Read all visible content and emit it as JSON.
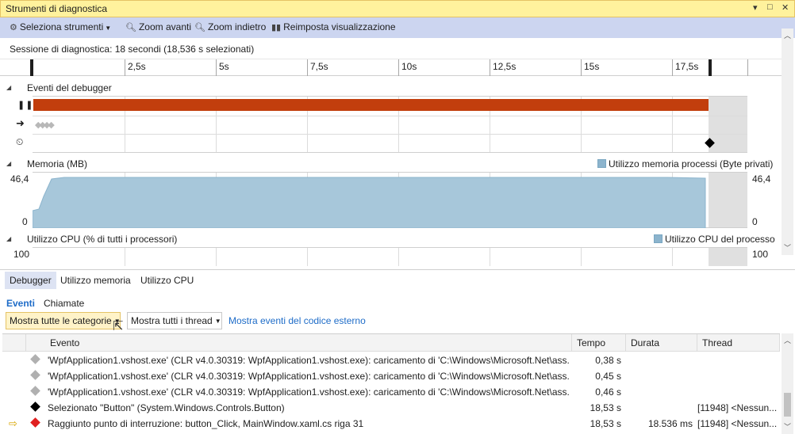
{
  "window": {
    "title": "Strumenti di diagnostica",
    "pin_glyph": "▾",
    "dock_glyph": "□",
    "close_glyph": "✕"
  },
  "toolbar": {
    "select_tools": "Seleziona strumenti",
    "zoom_in": "Zoom avanti",
    "zoom_out": "Zoom indietro",
    "reset_view": "Reimposta visualizzazione"
  },
  "session": {
    "label": "Sessione di diagnostica: 18 secondi (18,536 s selezionati)"
  },
  "ruler": {
    "ticks": [
      "2,5s",
      "5s",
      "7,5s",
      "10s",
      "12,5s",
      "15s",
      "17,5s"
    ]
  },
  "debugger_events": {
    "header": "Eventi del debugger",
    "break_color": "#c23e0d",
    "event_marker_color": "#000000"
  },
  "memory": {
    "header": "Memoria (MB)",
    "legend": "Utilizzo memoria processi (Byte privati)",
    "max_label": "46,4",
    "min_label": "0",
    "fill_color": "#a7c7da"
  },
  "cpu": {
    "header": "Utilizzo CPU (% di tutti i processori)",
    "legend": "Utilizzo CPU del processo",
    "max_label": "100"
  },
  "tabs": [
    "Debugger",
    "Utilizzo memoria",
    "Utilizzo CPU"
  ],
  "subtabs": [
    "Eventi",
    "Chiamate"
  ],
  "filters": {
    "categories": "Mostra tutte le categorie",
    "threads": "Mostra tutti i thread",
    "external_link": "Mostra eventi del codice esterno"
  },
  "table": {
    "columns": [
      "Evento",
      "Tempo",
      "Durata",
      "Thread"
    ],
    "rows": [
      {
        "icon": "gray-diamond-icon",
        "event": "'WpfApplication1.vshost.exe' (CLR v4.0.30319: WpfApplication1.vshost.exe): caricamento di 'C:\\Windows\\Microsoft.Net\\ass...",
        "time": "0,38 s",
        "duration": "",
        "thread": ""
      },
      {
        "icon": "gray-diamond-icon",
        "event": "'WpfApplication1.vshost.exe' (CLR v4.0.30319: WpfApplication1.vshost.exe): caricamento di 'C:\\Windows\\Microsoft.Net\\ass...",
        "time": "0,45 s",
        "duration": "",
        "thread": ""
      },
      {
        "icon": "gray-diamond-icon",
        "event": "'WpfApplication1.vshost.exe' (CLR v4.0.30319: WpfApplication1.vshost.exe): caricamento di 'C:\\Windows\\Microsoft.Net\\ass...",
        "time": "0,46 s",
        "duration": "",
        "thread": ""
      },
      {
        "icon": "black-diamond-icon",
        "event": "Selezionato \"Button\" (System.Windows.Controls.Button)",
        "time": "18,53 s",
        "duration": "",
        "thread": "[11948] <Nessun..."
      },
      {
        "icon": "red-diamond-icon",
        "event": "Raggiunto punto di interruzione: button_Click, MainWindow.xaml.cs riga 31",
        "time": "18,53 s",
        "duration": "18.536 ms",
        "thread": "[11948] <Nessun..."
      }
    ]
  }
}
